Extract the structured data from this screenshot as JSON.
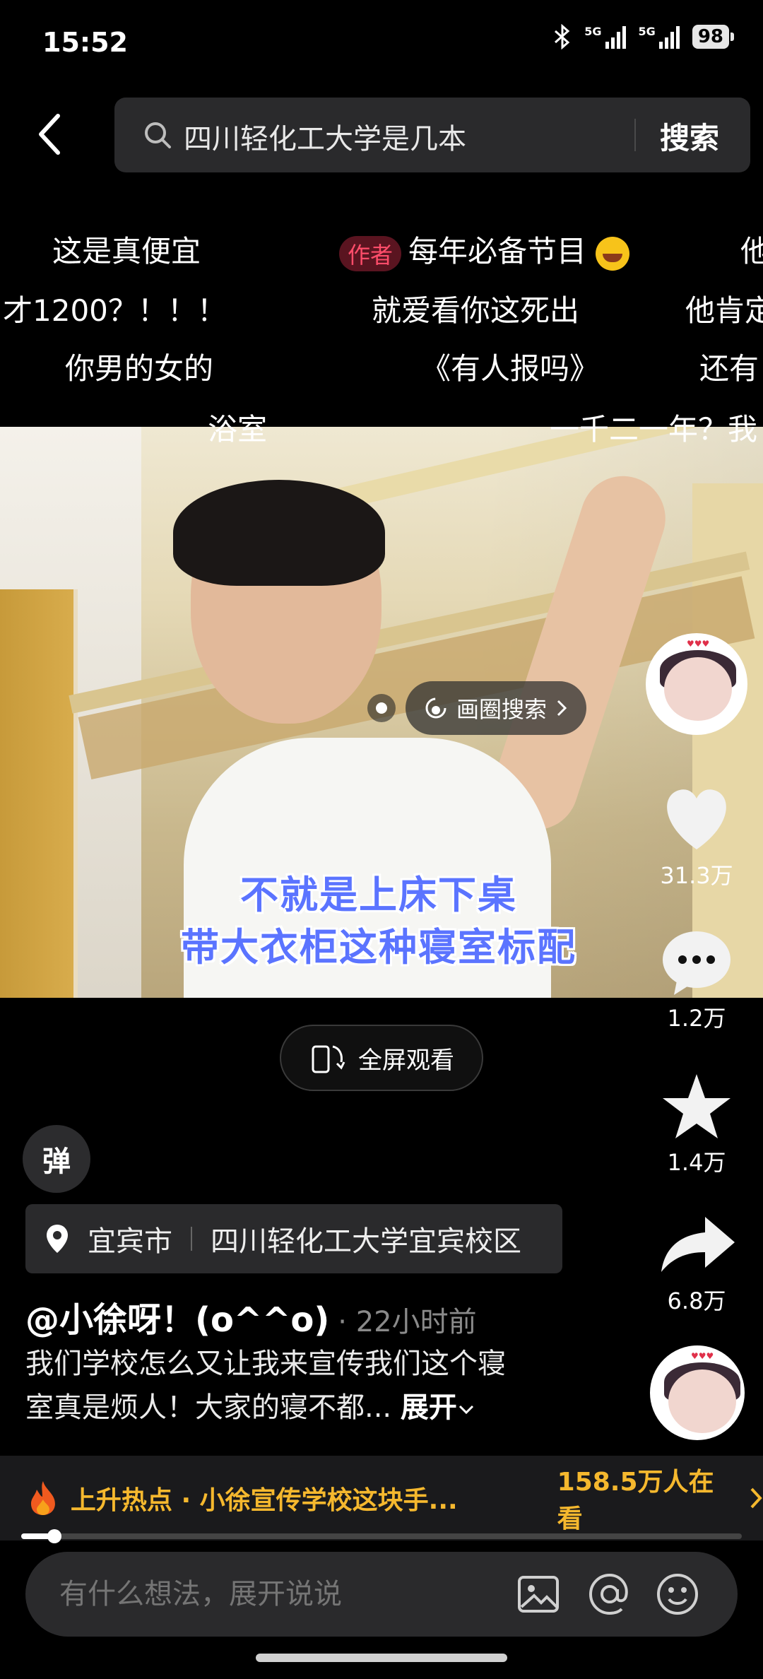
{
  "status_bar": {
    "time": "15:52",
    "net1": "5G",
    "net2": "5G",
    "battery": "98"
  },
  "search": {
    "query": "四川轻化工大学是几本",
    "button": "搜索"
  },
  "danmaku": {
    "row1": [
      "这是真便宜",
      "每年必备节目",
      "他"
    ],
    "author_tag": "作者",
    "row2": [
      "才1200？！！！",
      "就爱看你这死出",
      "他肯定"
    ],
    "row3": [
      "你男的女的",
      "《有人报吗》",
      "还有"
    ],
    "row4": [
      "浴室",
      "一千二一年？我"
    ]
  },
  "video": {
    "circle_search": "画圈搜索",
    "subtitle_line1": "不就是上床下桌",
    "subtitle_line2": "带大衣柜这种寝室标配"
  },
  "rail": {
    "likes": "31.3万",
    "comments": "1.2万",
    "favorites": "1.4万",
    "shares": "6.8万"
  },
  "fullscreen": "全屏观看",
  "danmaku_toggle": "弹",
  "location": {
    "city": "宜宾市",
    "place": "四川轻化工大学宜宾校区"
  },
  "post": {
    "author": "@小徐呀！(o^^o)",
    "time": "· 22小时前",
    "desc_line1": "我们学校怎么又让我来宣传我们这个寝",
    "desc_line2": "室真是烦人！大家的寝不都...",
    "expand": "展开"
  },
  "hot": {
    "title": "上升热点 · 小徐宣传学校这块手...",
    "count": "158.5万人在看"
  },
  "progress": {
    "fraction": 0.046
  },
  "comment": {
    "placeholder": "有什么想法，展开说说"
  },
  "colors": {
    "accent": "#f5b82e",
    "subtitle": "#5b74ff",
    "author_tag": "#ff4d6a"
  }
}
